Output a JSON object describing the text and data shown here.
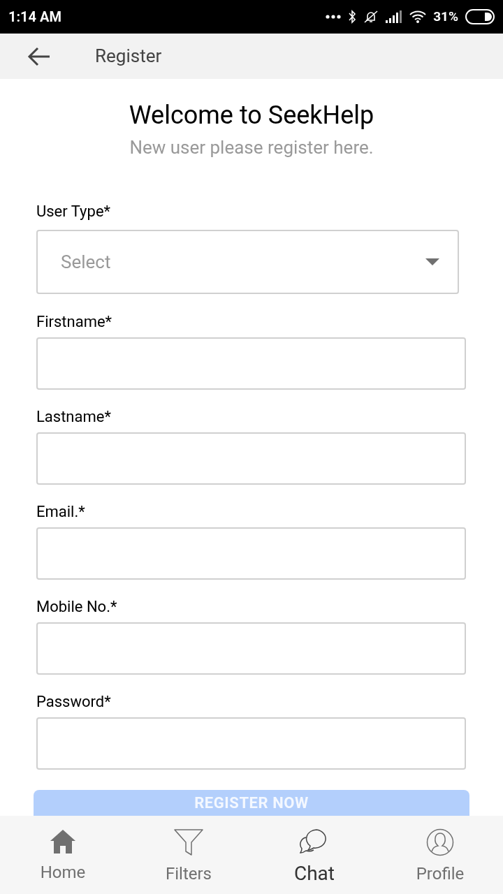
{
  "status_bar": {
    "time": "1:14 AM",
    "battery": "31%"
  },
  "header": {
    "title": "Register"
  },
  "intro": {
    "title": "Welcome to SeekHelp",
    "subtitle": "New user please register here."
  },
  "form": {
    "fields": [
      {
        "kind": "select",
        "label": "User Type*",
        "placeholder": "Select"
      },
      {
        "kind": "input",
        "label": "Firstname*"
      },
      {
        "kind": "input",
        "label": "Lastname*"
      },
      {
        "kind": "input",
        "label": "Email.*"
      },
      {
        "kind": "input",
        "label": "Mobile No.*"
      },
      {
        "kind": "input",
        "label": "Password*"
      }
    ],
    "submit": {
      "label": "REGISTER NOW",
      "disabled": true
    }
  },
  "bottom_nav": [
    {
      "kind": "home",
      "label": "Home",
      "selected": false
    },
    {
      "kind": "filters",
      "label": "Filters",
      "selected": false
    },
    {
      "kind": "chat",
      "label": "Chat",
      "selected": true
    },
    {
      "kind": "profile",
      "label": "Profile",
      "selected": false
    }
  ]
}
